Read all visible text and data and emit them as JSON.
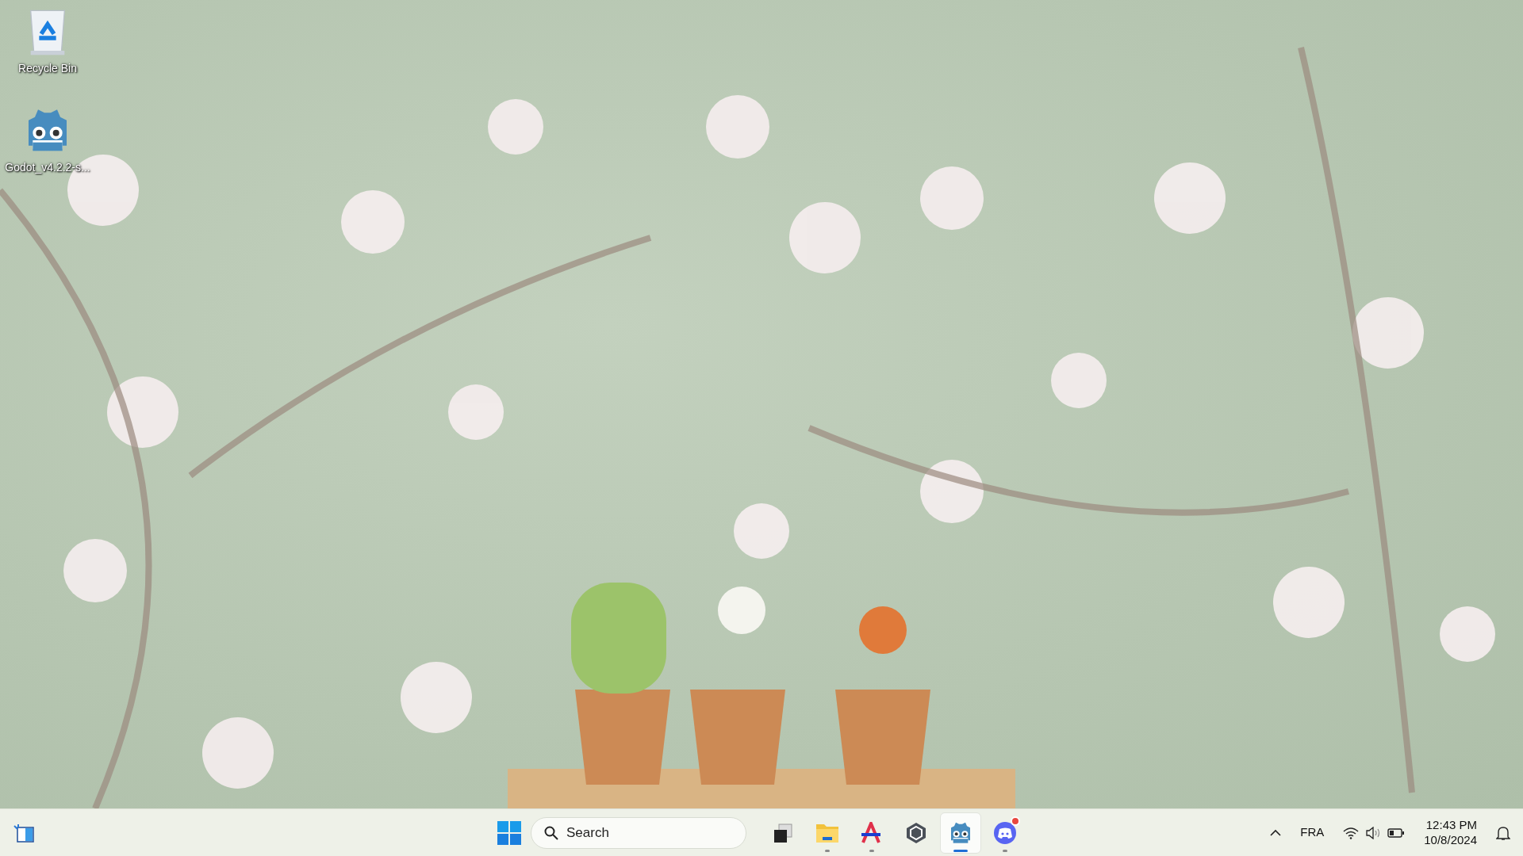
{
  "desktop": {
    "icons": [
      {
        "kind": "recycle-bin",
        "label": "Recycle Bin"
      },
      {
        "kind": "godot",
        "label": "Godot_v4.2.2-s..."
      }
    ]
  },
  "taskbar": {
    "search": {
      "placeholder": "Search"
    },
    "apps": [
      {
        "kind": "task-view",
        "running": false,
        "selected": false
      },
      {
        "kind": "folder",
        "running": true,
        "selected": false
      },
      {
        "kind": "letter-a",
        "running": true,
        "selected": false
      },
      {
        "kind": "unity",
        "running": false,
        "selected": false
      },
      {
        "kind": "godot",
        "running": true,
        "selected": true
      },
      {
        "kind": "chat",
        "running": true,
        "selected": false,
        "badge": true
      }
    ],
    "tray": {
      "language": "FRA",
      "time": "12:43 PM",
      "date": "10/8/2024"
    }
  }
}
